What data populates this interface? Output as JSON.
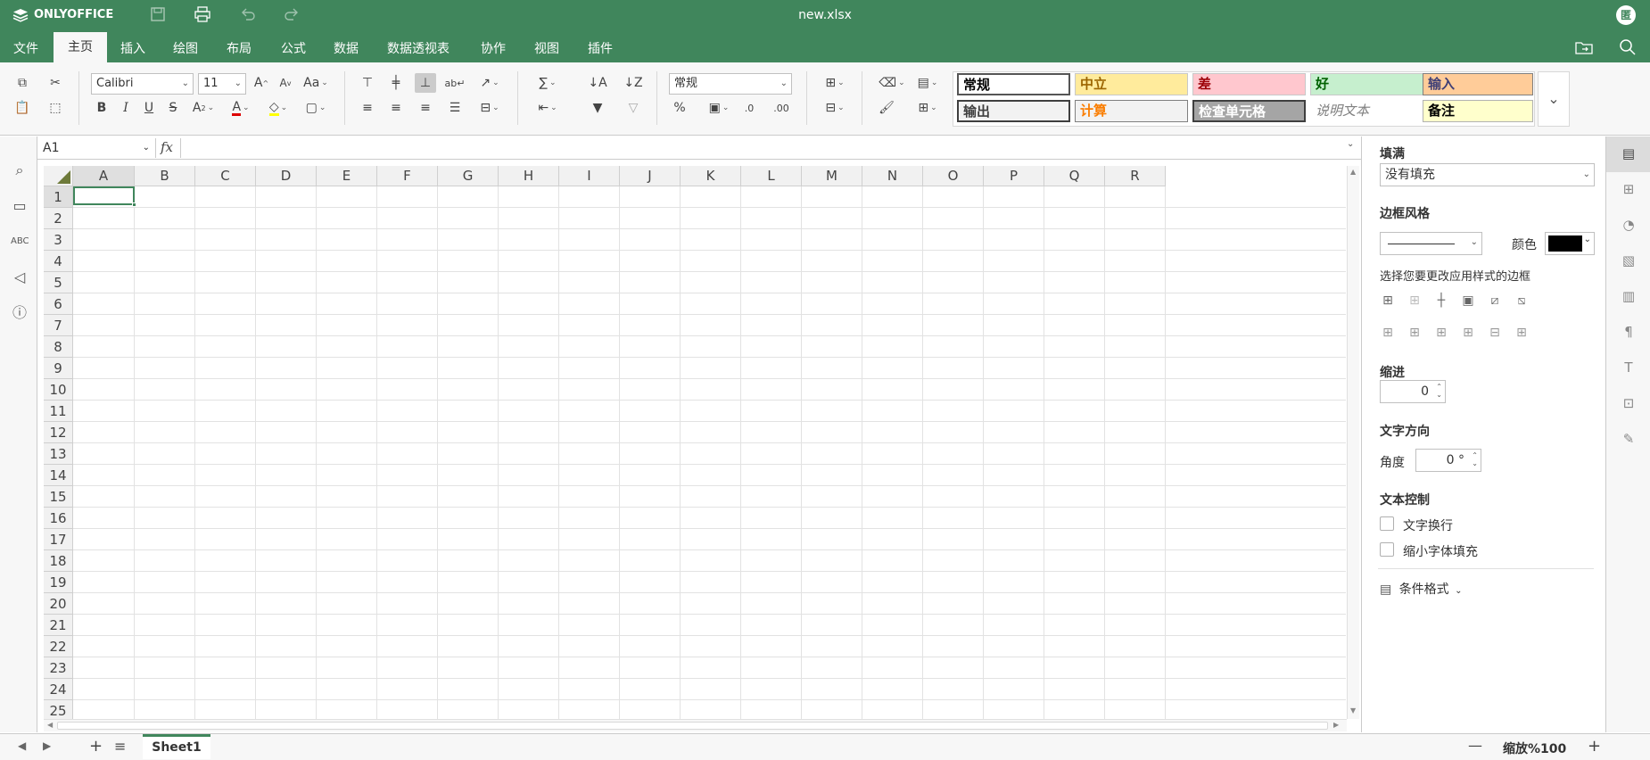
{
  "app": {
    "brand": "ONLYOFFICE",
    "file_name": "new.xlsx",
    "avatar_initial": "匿"
  },
  "menu_tabs": [
    "文件",
    "主页",
    "插入",
    "绘图",
    "布局",
    "公式",
    "数据",
    "数据透视表",
    "协作",
    "视图",
    "插件"
  ],
  "active_tab": "主页",
  "toolbar": {
    "font_name": "Calibri",
    "font_size": "11",
    "number_format": "常规",
    "percent_label": "%",
    "decrease_decimal": ".0",
    "increase_decimal": ".00"
  },
  "cell_styles": [
    {
      "label": "常规",
      "bg": "#ffffff",
      "color": "#000000",
      "border": "#555555"
    },
    {
      "label": "中立",
      "bg": "#ffeb9c",
      "color": "#9c6500",
      "border": "#c8c8c8"
    },
    {
      "label": "差",
      "bg": "#ffc7ce",
      "color": "#9c0006",
      "border": "#c8c8c8"
    },
    {
      "label": "好",
      "bg": "#c6efce",
      "color": "#006100",
      "border": "#c8c8c8"
    },
    {
      "label": "输入",
      "bg": "#ffcc99",
      "color": "#3f3f76",
      "border": "#7f7f7f"
    },
    {
      "label": "输出",
      "bg": "#f2f2f2",
      "color": "#3f3f3f",
      "border": "#3f3f3f"
    },
    {
      "label": "计算",
      "bg": "#f2f2f2",
      "color": "#fa7d00",
      "border": "#7f7f7f"
    },
    {
      "label": "检查单元格",
      "bg": "#a5a5a5",
      "color": "#ffffff",
      "border": "#3f3f3f"
    },
    {
      "label": "说明文本",
      "bg": "#ffffff",
      "color": "#7f7f7f",
      "border": "#ffffff"
    },
    {
      "label": "备注",
      "bg": "#ffffcc",
      "color": "#000000",
      "border": "#b2b2b2"
    }
  ],
  "formula_bar": {
    "cell_ref": "A1",
    "fx": "fx",
    "formula": ""
  },
  "columns": [
    "A",
    "B",
    "C",
    "D",
    "E",
    "F",
    "G",
    "H",
    "I",
    "J",
    "K",
    "L",
    "M",
    "N",
    "O",
    "P",
    "Q",
    "R"
  ],
  "rows": [
    "1",
    "2",
    "3",
    "4",
    "5",
    "6",
    "7",
    "8",
    "9",
    "10",
    "11",
    "12",
    "13",
    "14",
    "15",
    "16",
    "17",
    "18",
    "19",
    "20",
    "21",
    "22",
    "23",
    "24",
    "25"
  ],
  "selected_cell": "A1",
  "cell_settings": {
    "fill_label": "填满",
    "fill_value": "没有填充",
    "border_style_label": "边框风格",
    "color_label": "颜色",
    "border_color": "#000000",
    "border_hint": "选择您要更改应用样式的边框",
    "indent_label": "缩进",
    "indent_value": "0",
    "text_direction_label": "文字方向",
    "angle_label": "角度",
    "angle_value": "0 °",
    "text_control_label": "文本控制",
    "wrap_text_label": "文字换行",
    "shrink_fit_label": "缩小字体填充",
    "conditional_format_label": "条件格式"
  },
  "status": {
    "sheet_tab": "Sheet1",
    "zoom_label": "缩放%100"
  },
  "colors": {
    "brand_green": "#40865c",
    "active_tab_bg": "#f7f7f7"
  }
}
